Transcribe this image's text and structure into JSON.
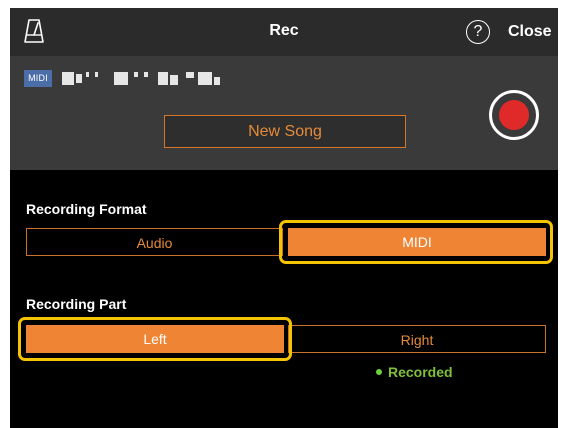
{
  "header": {
    "title": "Rec",
    "close_label": "Close",
    "help_glyph": "?",
    "icons": [
      "metronome-icon",
      "help-icon"
    ]
  },
  "song": {
    "badge": "MIDI",
    "new_song_label": "New Song",
    "record_icon": "record-icon"
  },
  "recording_format": {
    "label": "Recording Format",
    "options": [
      "Audio",
      "MIDI"
    ],
    "selected": "MIDI"
  },
  "recording_part": {
    "label": "Recording Part",
    "options": [
      "Left",
      "Right"
    ],
    "selected": "Left",
    "status": "Recorded"
  },
  "colors": {
    "accent": "#ee8434",
    "highlight": "#f5c400",
    "record": "#e02a2a",
    "recorded": "#7fbf3a"
  }
}
